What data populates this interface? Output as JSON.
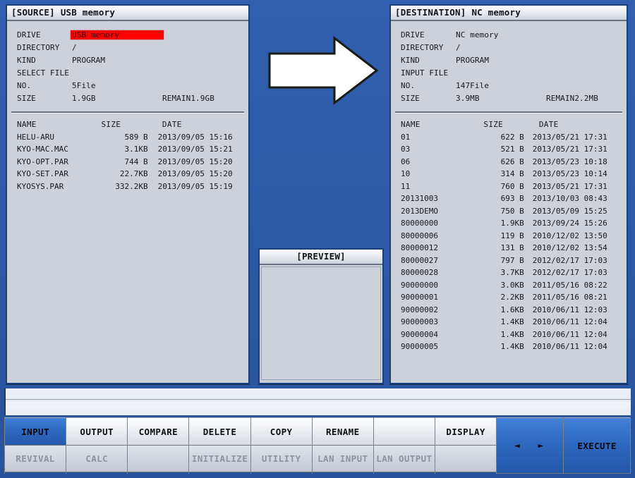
{
  "colors": {
    "background_blue": "#2d5ca8",
    "panel_bg": "#ccd1da",
    "panel_border": "#1d3f79",
    "highlight_red": "#ff0000",
    "softkey_active_blue": "#2f69c0"
  },
  "source": {
    "title_key": "[SOURCE]",
    "title_value": "USB memory",
    "info": [
      {
        "label": "DRIVE",
        "value": "USB memory",
        "extra": "",
        "highlight": true
      },
      {
        "label": "DIRECTORY",
        "value": "/",
        "extra": "",
        "highlight": false
      },
      {
        "label": "KIND",
        "value": "PROGRAM",
        "extra": "",
        "highlight": false
      },
      {
        "label": "SELECT FILE",
        "value": "",
        "extra": "",
        "highlight": false
      },
      {
        "label": "NO.",
        "value": "5File",
        "extra": "",
        "highlight": false
      },
      {
        "label": "SIZE",
        "value": "1.9GB",
        "extra": "REMAIN1.9GB",
        "highlight": false
      }
    ],
    "columns": {
      "name": "NAME",
      "size": "SIZE",
      "date": "DATE"
    },
    "files": [
      {
        "name": "HELU-ARU",
        "size": "589 B",
        "date": "2013/09/05 15:16"
      },
      {
        "name": "KYO-MAC.MAC",
        "size": "3.1KB",
        "date": "2013/09/05 15:21"
      },
      {
        "name": "KYO-OPT.PAR",
        "size": "744 B",
        "date": "2013/09/05 15:20"
      },
      {
        "name": "KYO-SET.PAR",
        "size": "22.7KB",
        "date": "2013/09/05 15:20"
      },
      {
        "name": "KYOSYS.PAR",
        "size": "332.2KB",
        "date": "2013/09/05 15:19"
      }
    ]
  },
  "destination": {
    "title_key": "[DESTINATION]",
    "title_value": "NC memory",
    "info": [
      {
        "label": "DRIVE",
        "value": "NC memory",
        "extra": "",
        "highlight": false
      },
      {
        "label": "DIRECTORY",
        "value": "/",
        "extra": "",
        "highlight": false
      },
      {
        "label": "KIND",
        "value": "PROGRAM",
        "extra": "",
        "highlight": false
      },
      {
        "label": "INPUT FILE",
        "value": "",
        "extra": "",
        "highlight": false
      },
      {
        "label": "NO.",
        "value": "147File",
        "extra": "",
        "highlight": false
      },
      {
        "label": "SIZE",
        "value": "3.9MB",
        "extra": "REMAIN2.2MB",
        "highlight": false
      }
    ],
    "columns": {
      "name": "NAME",
      "size": "SIZE",
      "date": "DATE"
    },
    "files": [
      {
        "name": "01",
        "size": "622 B",
        "date": "2013/05/21 17:31"
      },
      {
        "name": "03",
        "size": "521 B",
        "date": "2013/05/21 17:31"
      },
      {
        "name": "06",
        "size": "626 B",
        "date": "2013/05/23 10:18"
      },
      {
        "name": "10",
        "size": "314 B",
        "date": "2013/05/23 10:14"
      },
      {
        "name": "11",
        "size": "760 B",
        "date": "2013/05/21 17:31"
      },
      {
        "name": "20131003",
        "size": "693 B",
        "date": "2013/10/03 08:43"
      },
      {
        "name": "2013DEMO",
        "size": "750 B",
        "date": "2013/05/09 15:25"
      },
      {
        "name": "80000000",
        "size": "1.9KB",
        "date": "2013/09/24 15:26"
      },
      {
        "name": "80000006",
        "size": "119 B",
        "date": "2010/12/02 13:50"
      },
      {
        "name": "80000012",
        "size": "131 B",
        "date": "2010/12/02 13:54"
      },
      {
        "name": "80000027",
        "size": "797 B",
        "date": "2012/02/17 17:03"
      },
      {
        "name": "80000028",
        "size": "3.7KB",
        "date": "2012/02/17 17:03"
      },
      {
        "name": "90000000",
        "size": "3.0KB",
        "date": "2011/05/16 08:22"
      },
      {
        "name": "90000001",
        "size": "2.2KB",
        "date": "2011/05/16 08:21"
      },
      {
        "name": "90000002",
        "size": "1.6KB",
        "date": "2010/06/11 12:03"
      },
      {
        "name": "90000003",
        "size": "1.4KB",
        "date": "2010/06/11 12:04"
      },
      {
        "name": "90000004",
        "size": "1.4KB",
        "date": "2010/06/11 12:04"
      },
      {
        "name": "90000005",
        "size": "1.4KB",
        "date": "2010/06/11 12:04"
      }
    ]
  },
  "preview": {
    "title": "[PREVIEW]",
    "content": ""
  },
  "transfer_arrow": {
    "icon": "arrow-right-icon",
    "direction": "right"
  },
  "softkeys": {
    "columns": [
      {
        "top": "INPUT",
        "bottom": "REVIVAL",
        "active": true,
        "style": "normal"
      },
      {
        "top": "OUTPUT",
        "bottom": "CALC",
        "active": false,
        "style": "normal"
      },
      {
        "top": "COMPARE",
        "bottom": "",
        "active": false,
        "style": "normal"
      },
      {
        "top": "DELETE",
        "bottom": "INITIALIZE",
        "active": false,
        "style": "normal"
      },
      {
        "top": "COPY",
        "bottom": "UTILITY",
        "active": false,
        "style": "normal"
      },
      {
        "top": "RENAME",
        "bottom": "LAN INPUT",
        "active": false,
        "style": "normal"
      },
      {
        "top": "",
        "bottom": "LAN OUTPUT",
        "active": false,
        "style": "normal"
      },
      {
        "top": "DISPLAY",
        "bottom": "",
        "active": false,
        "style": "normal"
      }
    ],
    "paging": {
      "label": "◄ ►",
      "icon": "page-left-right-icon"
    },
    "execute": {
      "label": "EXECUTE"
    }
  }
}
